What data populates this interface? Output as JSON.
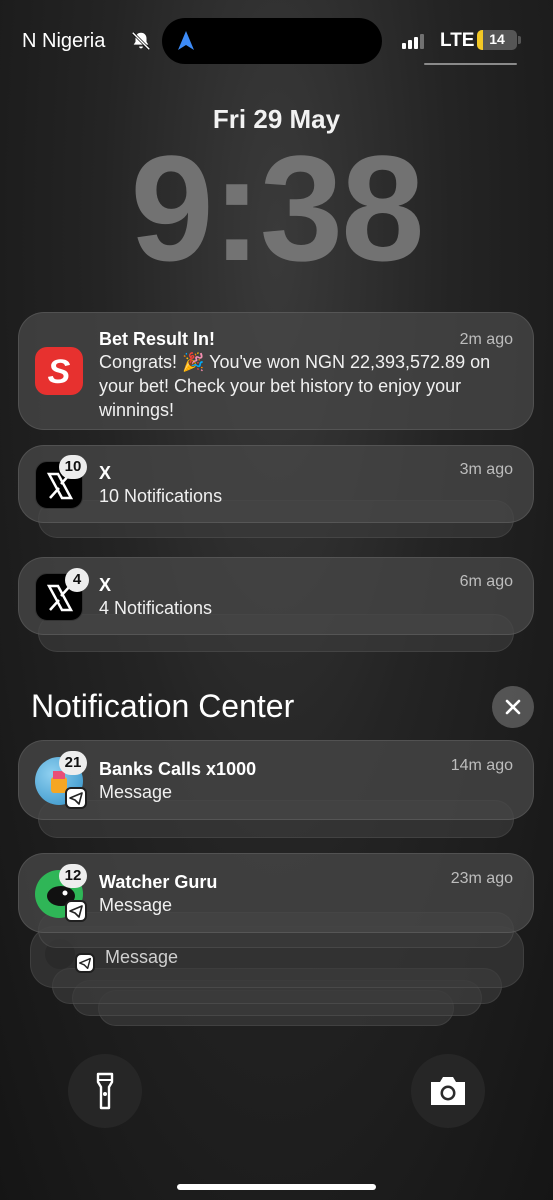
{
  "status_bar": {
    "carrier": "N Nigeria",
    "network": "LTE",
    "battery_level": "14",
    "signal_bars": 3
  },
  "lock_screen": {
    "date": "Fri 29 May",
    "time": "9:38"
  },
  "notifications": [
    {
      "app_icon": "sporty-s-icon",
      "title": "Bet Result In!",
      "time": "2m ago",
      "body": "Congrats! 🎉 You've won NGN 22,393,572.89 on your bet! Check your bet history to enjoy your winnings!"
    },
    {
      "app_icon": "x-logo-icon",
      "badge": "10",
      "title": "X",
      "time": "3m ago",
      "body": "10 Notifications"
    },
    {
      "app_icon": "x-logo-icon",
      "badge": "4",
      "title": "X",
      "time": "6m ago",
      "body": "4 Notifications"
    }
  ],
  "notification_center": {
    "title": "Notification Center",
    "items": [
      {
        "app_icon": "telegram-icon",
        "badge": "21",
        "title": "Banks Calls x1000",
        "time": "14m ago",
        "body": "Message"
      },
      {
        "app_icon": "telegram-icon",
        "badge": "12",
        "title": "Watcher Guru",
        "time": "23m ago",
        "body": "Message"
      },
      {
        "app_icon": "telegram-icon",
        "body": "Message"
      }
    ]
  },
  "buttons": {
    "left": "flashlight-icon",
    "right": "camera-icon"
  },
  "colors": {
    "battery_fill": "#f3c824",
    "sporty_red": "#e7312f",
    "telegram_blue": "#2aa3df"
  }
}
